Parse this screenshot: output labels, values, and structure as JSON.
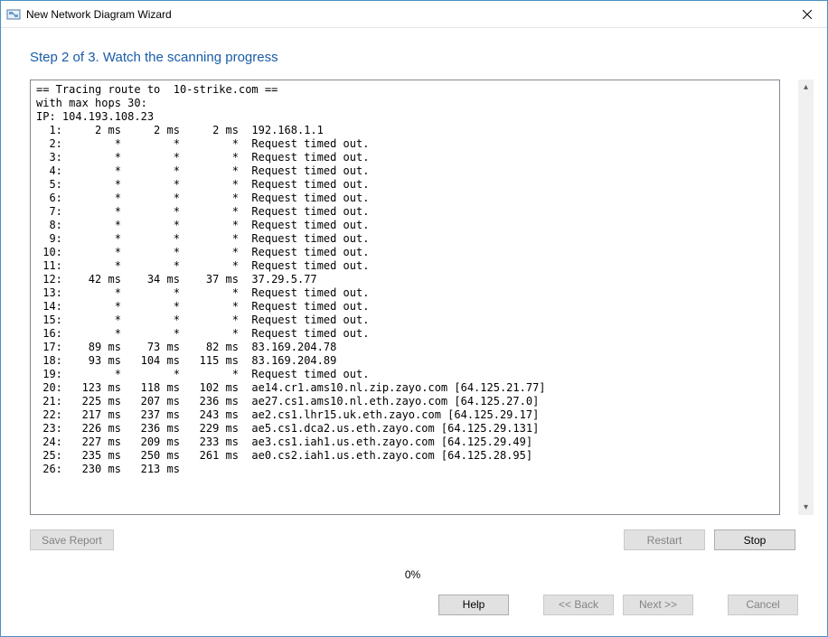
{
  "window": {
    "title": "New Network Diagram Wizard"
  },
  "heading": "Step 2 of 3. Watch the scanning progress",
  "trace": {
    "header1": "== Tracing route to  10-strike.com ==",
    "header2": "with max hops 30:",
    "header3": "IP: 104.193.108.23",
    "hops": [
      {
        "n": 1,
        "t1": "2 ms",
        "t2": "2 ms",
        "t3": "2 ms",
        "host": "192.168.1.1"
      },
      {
        "n": 2,
        "t1": "*",
        "t2": "*",
        "t3": "*",
        "host": "Request timed out."
      },
      {
        "n": 3,
        "t1": "*",
        "t2": "*",
        "t3": "*",
        "host": "Request timed out."
      },
      {
        "n": 4,
        "t1": "*",
        "t2": "*",
        "t3": "*",
        "host": "Request timed out."
      },
      {
        "n": 5,
        "t1": "*",
        "t2": "*",
        "t3": "*",
        "host": "Request timed out."
      },
      {
        "n": 6,
        "t1": "*",
        "t2": "*",
        "t3": "*",
        "host": "Request timed out."
      },
      {
        "n": 7,
        "t1": "*",
        "t2": "*",
        "t3": "*",
        "host": "Request timed out."
      },
      {
        "n": 8,
        "t1": "*",
        "t2": "*",
        "t3": "*",
        "host": "Request timed out."
      },
      {
        "n": 9,
        "t1": "*",
        "t2": "*",
        "t3": "*",
        "host": "Request timed out."
      },
      {
        "n": 10,
        "t1": "*",
        "t2": "*",
        "t3": "*",
        "host": "Request timed out."
      },
      {
        "n": 11,
        "t1": "*",
        "t2": "*",
        "t3": "*",
        "host": "Request timed out."
      },
      {
        "n": 12,
        "t1": "42 ms",
        "t2": "34 ms",
        "t3": "37 ms",
        "host": "37.29.5.77"
      },
      {
        "n": 13,
        "t1": "*",
        "t2": "*",
        "t3": "*",
        "host": "Request timed out."
      },
      {
        "n": 14,
        "t1": "*",
        "t2": "*",
        "t3": "*",
        "host": "Request timed out."
      },
      {
        "n": 15,
        "t1": "*",
        "t2": "*",
        "t3": "*",
        "host": "Request timed out."
      },
      {
        "n": 16,
        "t1": "*",
        "t2": "*",
        "t3": "*",
        "host": "Request timed out."
      },
      {
        "n": 17,
        "t1": "89 ms",
        "t2": "73 ms",
        "t3": "82 ms",
        "host": "83.169.204.78"
      },
      {
        "n": 18,
        "t1": "93 ms",
        "t2": "104 ms",
        "t3": "115 ms",
        "host": "83.169.204.89"
      },
      {
        "n": 19,
        "t1": "*",
        "t2": "*",
        "t3": "*",
        "host": "Request timed out."
      },
      {
        "n": 20,
        "t1": "123 ms",
        "t2": "118 ms",
        "t3": "102 ms",
        "host": "ae14.cr1.ams10.nl.zip.zayo.com [64.125.21.77]"
      },
      {
        "n": 21,
        "t1": "225 ms",
        "t2": "207 ms",
        "t3": "236 ms",
        "host": "ae27.cs1.ams10.nl.eth.zayo.com [64.125.27.0]"
      },
      {
        "n": 22,
        "t1": "217 ms",
        "t2": "237 ms",
        "t3": "243 ms",
        "host": "ae2.cs1.lhr15.uk.eth.zayo.com [64.125.29.17]"
      },
      {
        "n": 23,
        "t1": "226 ms",
        "t2": "236 ms",
        "t3": "229 ms",
        "host": "ae5.cs1.dca2.us.eth.zayo.com [64.125.29.131]"
      },
      {
        "n": 24,
        "t1": "227 ms",
        "t2": "209 ms",
        "t3": "233 ms",
        "host": "ae3.cs1.iah1.us.eth.zayo.com [64.125.29.49]"
      },
      {
        "n": 25,
        "t1": "235 ms",
        "t2": "250 ms",
        "t3": "261 ms",
        "host": "ae0.cs2.iah1.us.eth.zayo.com [64.125.28.95]"
      },
      {
        "n": 26,
        "t1": "230 ms",
        "t2": "213 ms",
        "t3": "",
        "host": ""
      }
    ]
  },
  "progress_text": "0%",
  "buttons": {
    "save_report": "Save Report",
    "restart": "Restart",
    "stop": "Stop",
    "help": "Help",
    "back": "<< Back",
    "next": "Next >>",
    "cancel": "Cancel"
  }
}
